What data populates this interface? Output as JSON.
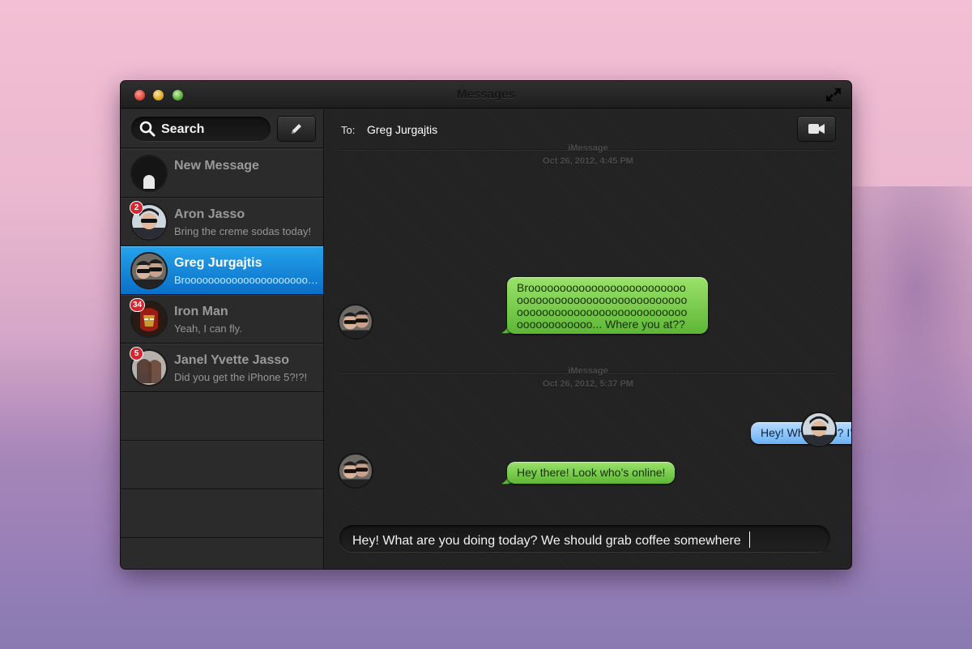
{
  "window": {
    "title": "Messages"
  },
  "sidebar": {
    "search_label": "Search",
    "new_message": {
      "label": "New Message"
    },
    "conversations": [
      {
        "name": "Aron Jasso",
        "preview": "Bring the creme sodas today!",
        "badge": "2",
        "selected": false
      },
      {
        "name": "Greg Jurgajtis",
        "preview": "Brooooooooooooooooooooooooooooooo",
        "badge": "",
        "selected": true
      },
      {
        "name": "Iron Man",
        "preview": "Yeah, I can fly.",
        "badge": "34",
        "selected": false
      },
      {
        "name": "Janel Yvette Jasso",
        "preview": "Did you get the iPhone 5?!?!",
        "badge": "5",
        "selected": false
      }
    ]
  },
  "chat": {
    "to_label": "To:",
    "recipient": "Greg Jurgajtis",
    "sections": [
      {
        "service": "iMessage",
        "timestamp": "Oct 26, 2012, 4:45 PM"
      },
      {
        "service": "iMessage",
        "timestamp": "Oct 26, 2012, 5:37 PM"
      }
    ],
    "messages": [
      {
        "from": "Greg Jurgajtis",
        "direction": "incoming",
        "lines": [
          "Brooooooooooooooooooooooooo",
          "ooooooooooooooooooooooooooo",
          "ooooooooooooooooooooooooooo",
          "oooooooooooo... Where you at??"
        ]
      },
      {
        "from": "me",
        "direction": "outgoing",
        "text": "Hey! What’s up? I’m online."
      },
      {
        "from": "Greg Jurgajtis",
        "direction": "incoming",
        "text": "Hey there! Look who’s online!"
      }
    ],
    "composer_text": "Hey! What are you doing today? We should grab coffee somewhere"
  },
  "colors": {
    "selected_row": "#0f82d8",
    "incoming_bubble": "#7fcf4f",
    "outgoing_bubble": "#8cc6fa",
    "badge": "#d7262f"
  },
  "icons": [
    "close-icon",
    "minimize-icon",
    "zoom-icon",
    "fullscreen-icon",
    "search-icon",
    "compose-pencil-icon",
    "video-camera-icon"
  ]
}
